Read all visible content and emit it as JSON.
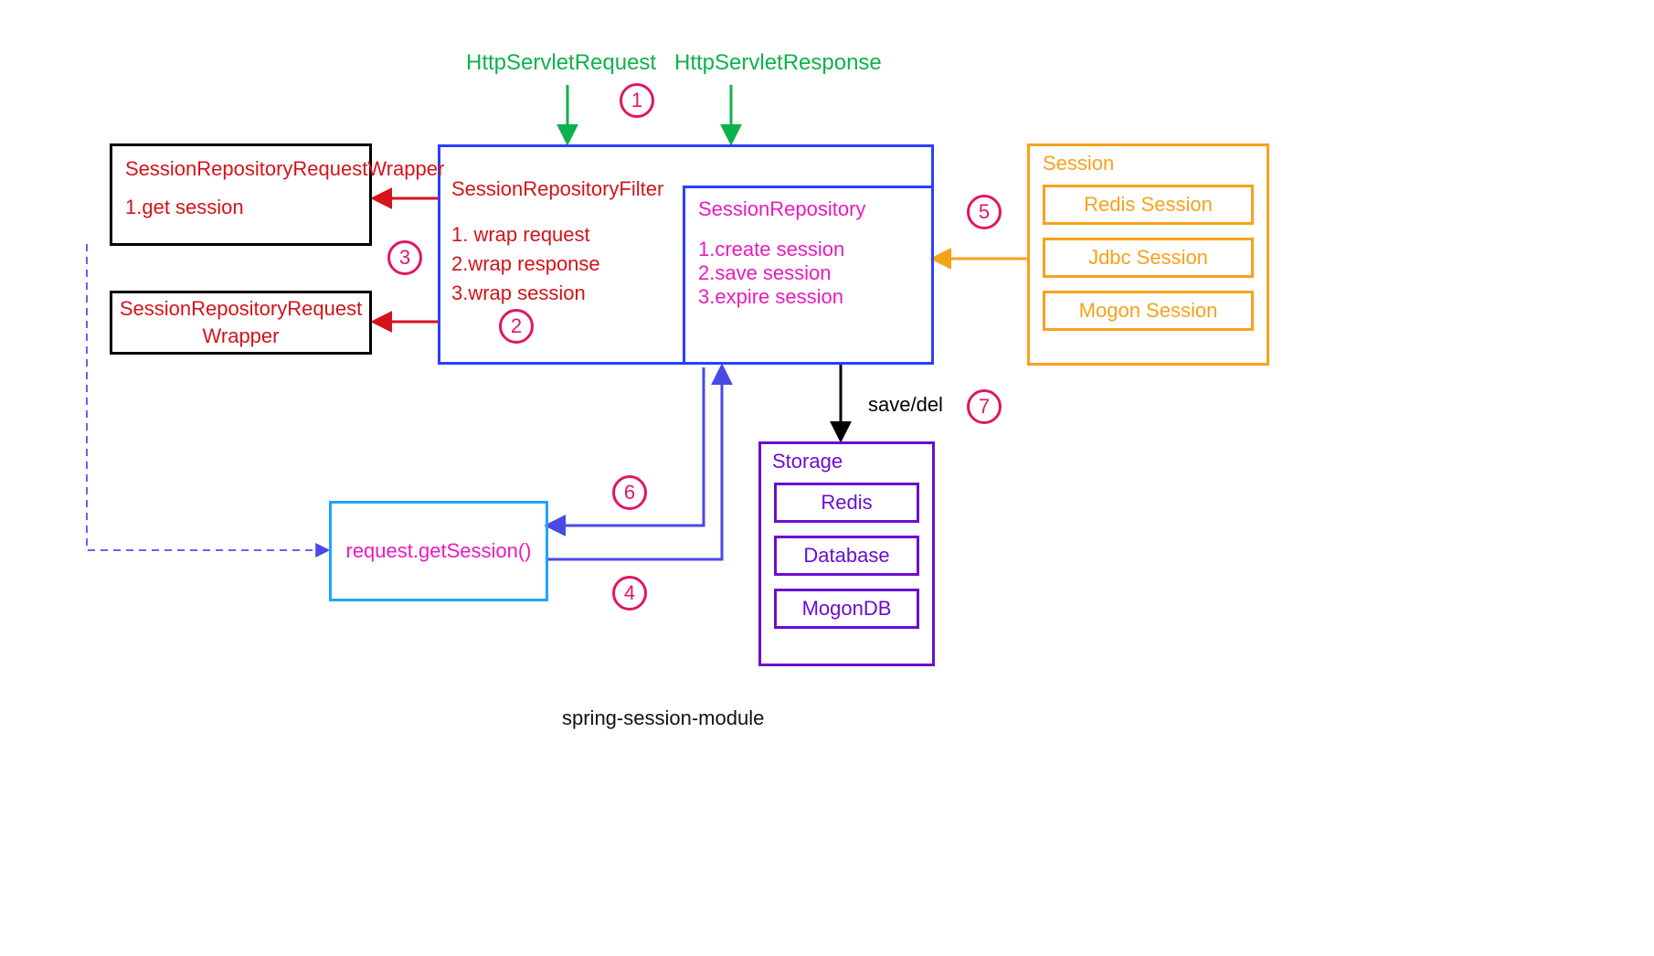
{
  "top": {
    "request_label": "HttpServletRequest",
    "response_label": "HttpServletResponse"
  },
  "filter": {
    "title": "SessionRepositoryFilter",
    "line1": "1. wrap request",
    "line2": "2.wrap response",
    "line3": "3.wrap session"
  },
  "repository": {
    "title": "SessionRepository",
    "line1": "1.create session",
    "line2": "2.save session",
    "line3": "3.expire session"
  },
  "wrapper1": {
    "title": "SessionRepositoryRequestWrapper",
    "line1": "1.get session"
  },
  "wrapper2": {
    "title": "SessionRepositoryRequestWrapper"
  },
  "session": {
    "title": "Session",
    "items": [
      "Redis Session",
      "Jdbc Session",
      "Mogon Session"
    ]
  },
  "storage": {
    "title": "Storage",
    "items": [
      "Redis",
      "Database",
      "MogonDB"
    ]
  },
  "getSession": {
    "label": "request.getSession()"
  },
  "save_del_label": "save/del",
  "caption": "spring-session-module",
  "steps": {
    "s1": "1",
    "s2": "2",
    "s3": "3",
    "s4": "4",
    "s5": "5",
    "s6": "6",
    "s7": "7"
  }
}
